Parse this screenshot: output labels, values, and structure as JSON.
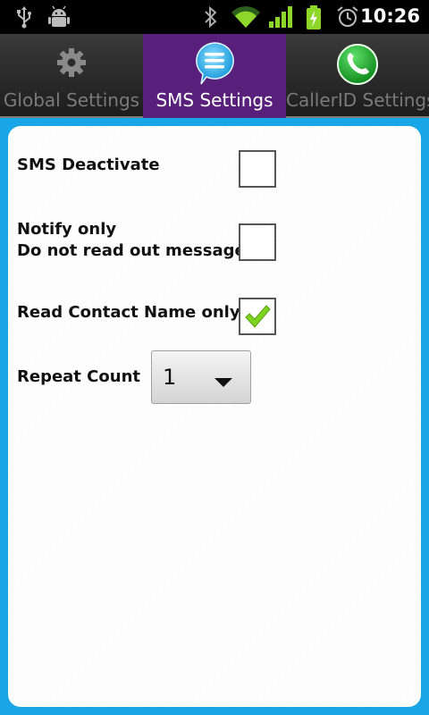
{
  "status_bar": {
    "time": "10:26",
    "icons": [
      "usb-icon",
      "android-debug-icon",
      "bluetooth-icon",
      "wifi-icon",
      "signal-icon",
      "battery-charging-icon",
      "alarm-icon"
    ]
  },
  "tabs": [
    {
      "label": "Global Settings",
      "icon": "gear-icon",
      "active": false
    },
    {
      "label": "SMS Settings",
      "icon": "message-bubble-icon",
      "active": true
    },
    {
      "label": "CallerID Settings",
      "icon": "phone-icon",
      "active": false
    }
  ],
  "settings": {
    "sms_deactivate": {
      "label": "SMS Deactivate",
      "checked": false
    },
    "notify_only": {
      "label_line1": "Notify only",
      "label_line2": "Do not read out message",
      "checked": false
    },
    "read_contact_name": {
      "label": "Read Contact Name only",
      "checked": true
    },
    "repeat_count": {
      "label": "Repeat Count",
      "value": "1"
    }
  },
  "colors": {
    "active_tab": "#58207a",
    "frame": "#19a6e6",
    "check": "#7ed321"
  }
}
